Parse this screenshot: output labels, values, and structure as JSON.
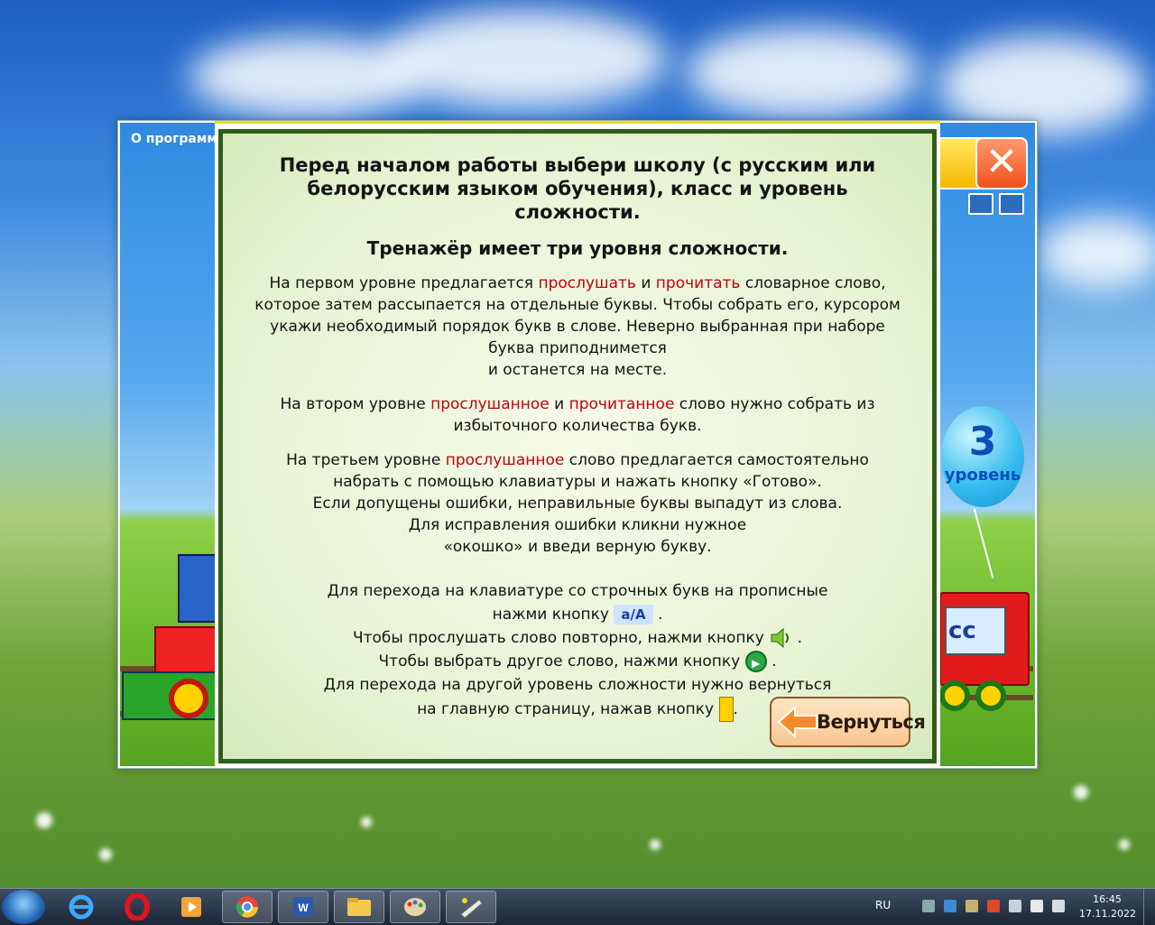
{
  "app": {
    "title": "О программ",
    "balloon_number": "3",
    "balloon_level": "уровень",
    "wagon_text": "сс"
  },
  "dialog": {
    "heading": "Перед началом работы выбери школу (с русским или белорусским языком обучения), класс и уровень сложности.",
    "subheading": "Тренажёр имеет три уровня сложности.",
    "level1": {
      "part1": "На первом уровне предлагается ",
      "red1": "прослушать",
      "part2": " и ",
      "red2": "прочитать",
      "part3": " словарное слово, которое затем рассыпается на отдельные буквы. Чтобы собрать его, курсором укажи необходимый порядок букв в слове. Неверно выбранная при наборе буква приподнимется",
      "part4": "и останется на месте."
    },
    "level2": {
      "part1": "На втором уровне ",
      "red1": "прослушанное",
      "part2": " и ",
      "red2": "прочитанное",
      "part3": " слово нужно собрать из избыточного количества букв."
    },
    "level3": {
      "part1": "На третьем уровне ",
      "red1": "прослушанное",
      "part2": " слово предлагается самостоятельно набрать с помощью клавиатуры и нажать кнопку «Готово».",
      "line2": "Если допущены ошибки, неправильные буквы выпадут из слова.",
      "line3": "Для исправления ошибки кликни нужное",
      "line4": "«окошко» и введи верную букву."
    },
    "tips": {
      "case_line1": "Для перехода на клавиатуре со строчных букв на прописные",
      "case_line2": "нажми кнопку",
      "case_key": "а/А",
      "repeat": "Чтобы прослушать слово повторно, нажми кнопку",
      "other_word": "Чтобы выбрать другое слово, нажми кнопку",
      "level_line1": "Для перехода на другой уровень сложности нужно вернуться",
      "level_line2": "на главную страницу, нажав кнопку",
      "dot": "."
    },
    "back_button": "Вернуться"
  },
  "taskbar": {
    "language": "RU",
    "time": "16:45",
    "date": "17.11.2022"
  },
  "colors": {
    "highlight_red": "#c00010",
    "dialog_border": "#2f5d1a",
    "taskbar": "#1b2636"
  }
}
